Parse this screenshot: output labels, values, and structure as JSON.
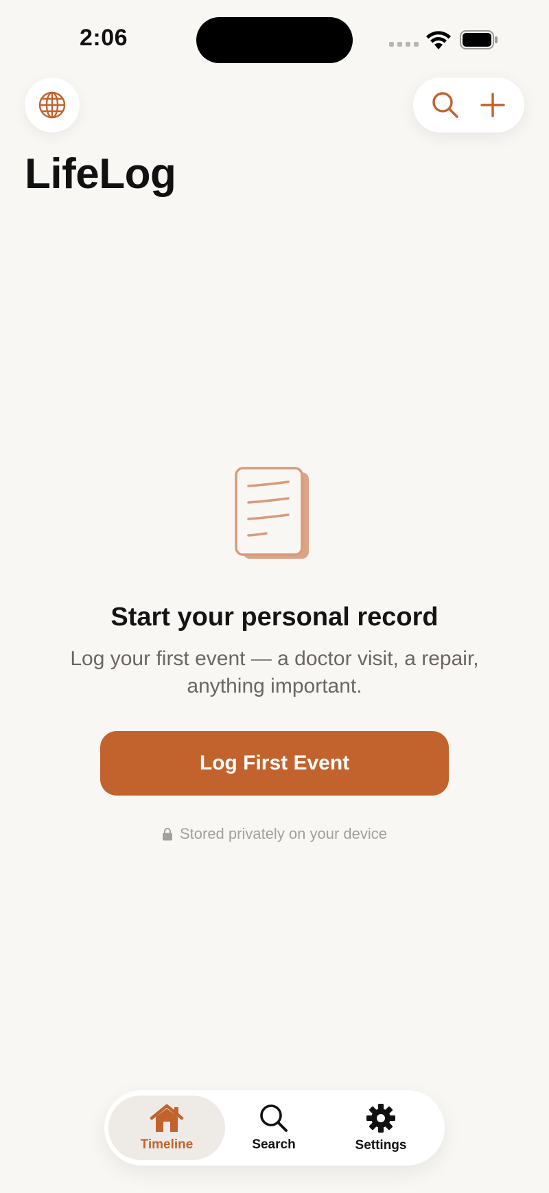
{
  "status_bar": {
    "time": "2:06"
  },
  "header": {
    "title": "LifeLog",
    "globe_icon": "globe-icon",
    "search_icon": "search-icon",
    "add_icon": "plus-icon"
  },
  "empty_state": {
    "icon": "document-icon",
    "heading": "Start your personal record",
    "body": "Log your first event — a doctor visit, a repair, anything important.",
    "button_label": "Log First Event",
    "privacy_note": "Stored privately on your device"
  },
  "tab_bar": {
    "items": [
      {
        "label": "Timeline",
        "icon": "house-icon",
        "active": true
      },
      {
        "label": "Search",
        "icon": "search-icon",
        "active": false
      },
      {
        "label": "Settings",
        "icon": "gear-icon",
        "active": false
      }
    ]
  },
  "colors": {
    "accent": "#c2622c",
    "background": "#f9f7f4",
    "muted_text": "#6b6660"
  }
}
